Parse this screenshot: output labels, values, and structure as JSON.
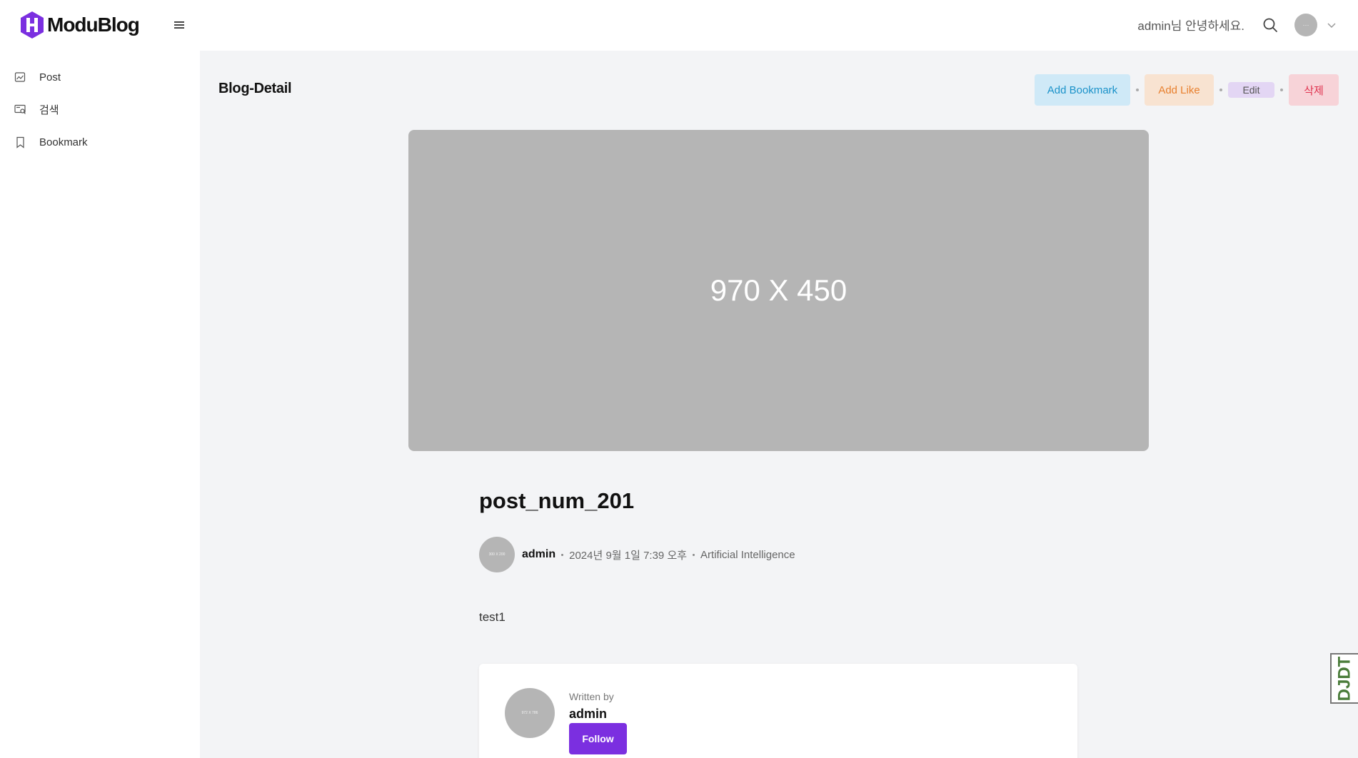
{
  "app": {
    "name": "ModuBlog"
  },
  "header": {
    "greeting": "admin님 안녕하세요.",
    "avatar_text": "···"
  },
  "sidebar": {
    "items": [
      {
        "label": "Post",
        "icon": "post-icon"
      },
      {
        "label": "검색",
        "icon": "search-list-icon"
      },
      {
        "label": "Bookmark",
        "icon": "bookmark-icon"
      }
    ]
  },
  "page": {
    "title": "Blog-Detail",
    "actions": {
      "bookmark": "Add Bookmark",
      "like": "Add Like",
      "edit": "Edit",
      "delete": "삭제"
    }
  },
  "post": {
    "image_placeholder": "970 X 450",
    "title": "post_num_201",
    "author": "admin",
    "date": "2024년 9월 1일 7:39 오후",
    "category": "Artificial Intelligence",
    "body": "test1",
    "author_avatar_text": "300 X 200"
  },
  "author_card": {
    "written_by": "Written by",
    "name": "admin",
    "follow": "Follow",
    "avatar_text": "972 X 786"
  },
  "side_tab": {
    "label": "DJDT"
  },
  "colors": {
    "accent": "#7b2fe0",
    "bookmark_bg": "#cfe9f7",
    "like_bg": "#f8e3d1",
    "edit_bg": "#e3d6f4",
    "delete_bg": "#f7d3d8"
  }
}
